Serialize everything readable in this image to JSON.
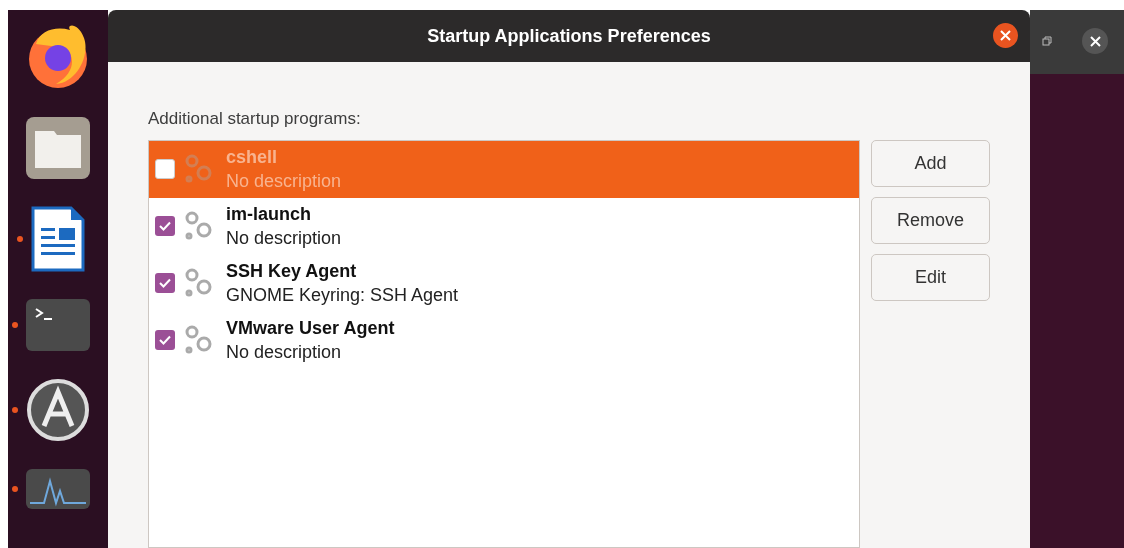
{
  "dock": [
    {
      "kind": "browser",
      "running": false
    },
    {
      "kind": "files",
      "running": false
    },
    {
      "kind": "writer",
      "running": true
    },
    {
      "kind": "terminal",
      "running": true
    },
    {
      "kind": "software",
      "running": true
    },
    {
      "kind": "monitor",
      "running": true
    }
  ],
  "window": {
    "title": "Startup Applications Preferences"
  },
  "list_label": "Additional startup programs:",
  "programs": [
    {
      "name": "cshell",
      "description": "No description",
      "checked": false,
      "selected": true
    },
    {
      "name": "im-launch",
      "description": "No description",
      "checked": true,
      "selected": false
    },
    {
      "name": "SSH Key Agent",
      "description": "GNOME Keyring: SSH Agent",
      "checked": true,
      "selected": false
    },
    {
      "name": "VMware User Agent",
      "description": "No description",
      "checked": true,
      "selected": false
    }
  ],
  "buttons": [
    "Add",
    "Remove",
    "Edit"
  ]
}
